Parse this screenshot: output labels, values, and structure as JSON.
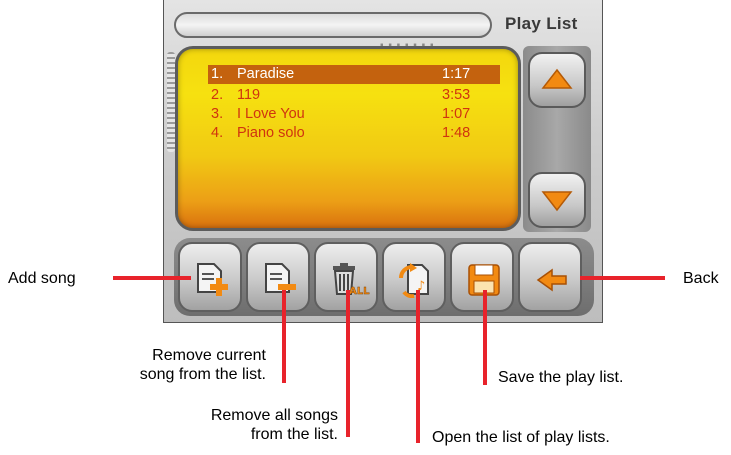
{
  "header": {
    "title": "Play List"
  },
  "playlist": {
    "items": [
      {
        "num": "1.",
        "name": "Paradise",
        "time": "1:17",
        "selected": true
      },
      {
        "num": "2.",
        "name": "119",
        "time": "3:53"
      },
      {
        "num": "3.",
        "name": "I Love You",
        "time": "1:07"
      },
      {
        "num": "4.",
        "name": "Piano solo",
        "time": "1:48"
      }
    ]
  },
  "scroll": {
    "up_icon": "triangle-up-icon",
    "down_icon": "triangle-down-icon"
  },
  "toolbar": {
    "buttons": [
      {
        "icon": "add-song-icon"
      },
      {
        "icon": "remove-song-icon"
      },
      {
        "icon": "trash-all-icon",
        "badge": "ALL"
      },
      {
        "icon": "open-playlists-icon"
      },
      {
        "icon": "save-disk-icon"
      },
      {
        "icon": "back-arrow-icon"
      }
    ]
  },
  "annotations": {
    "add_song": "Add song",
    "back": "Back",
    "remove_current_1": "Remove current",
    "remove_current_2": "song from the list.",
    "save": "Save the play list.",
    "remove_all_1": "Remove all songs",
    "remove_all_2": "from the list.",
    "open_lists": "Open the list of play lists."
  },
  "colors": {
    "accent": "#e8232b",
    "list_text": "#d0340f",
    "selection": "#c4620e",
    "icon_orange": "#f28a12"
  }
}
